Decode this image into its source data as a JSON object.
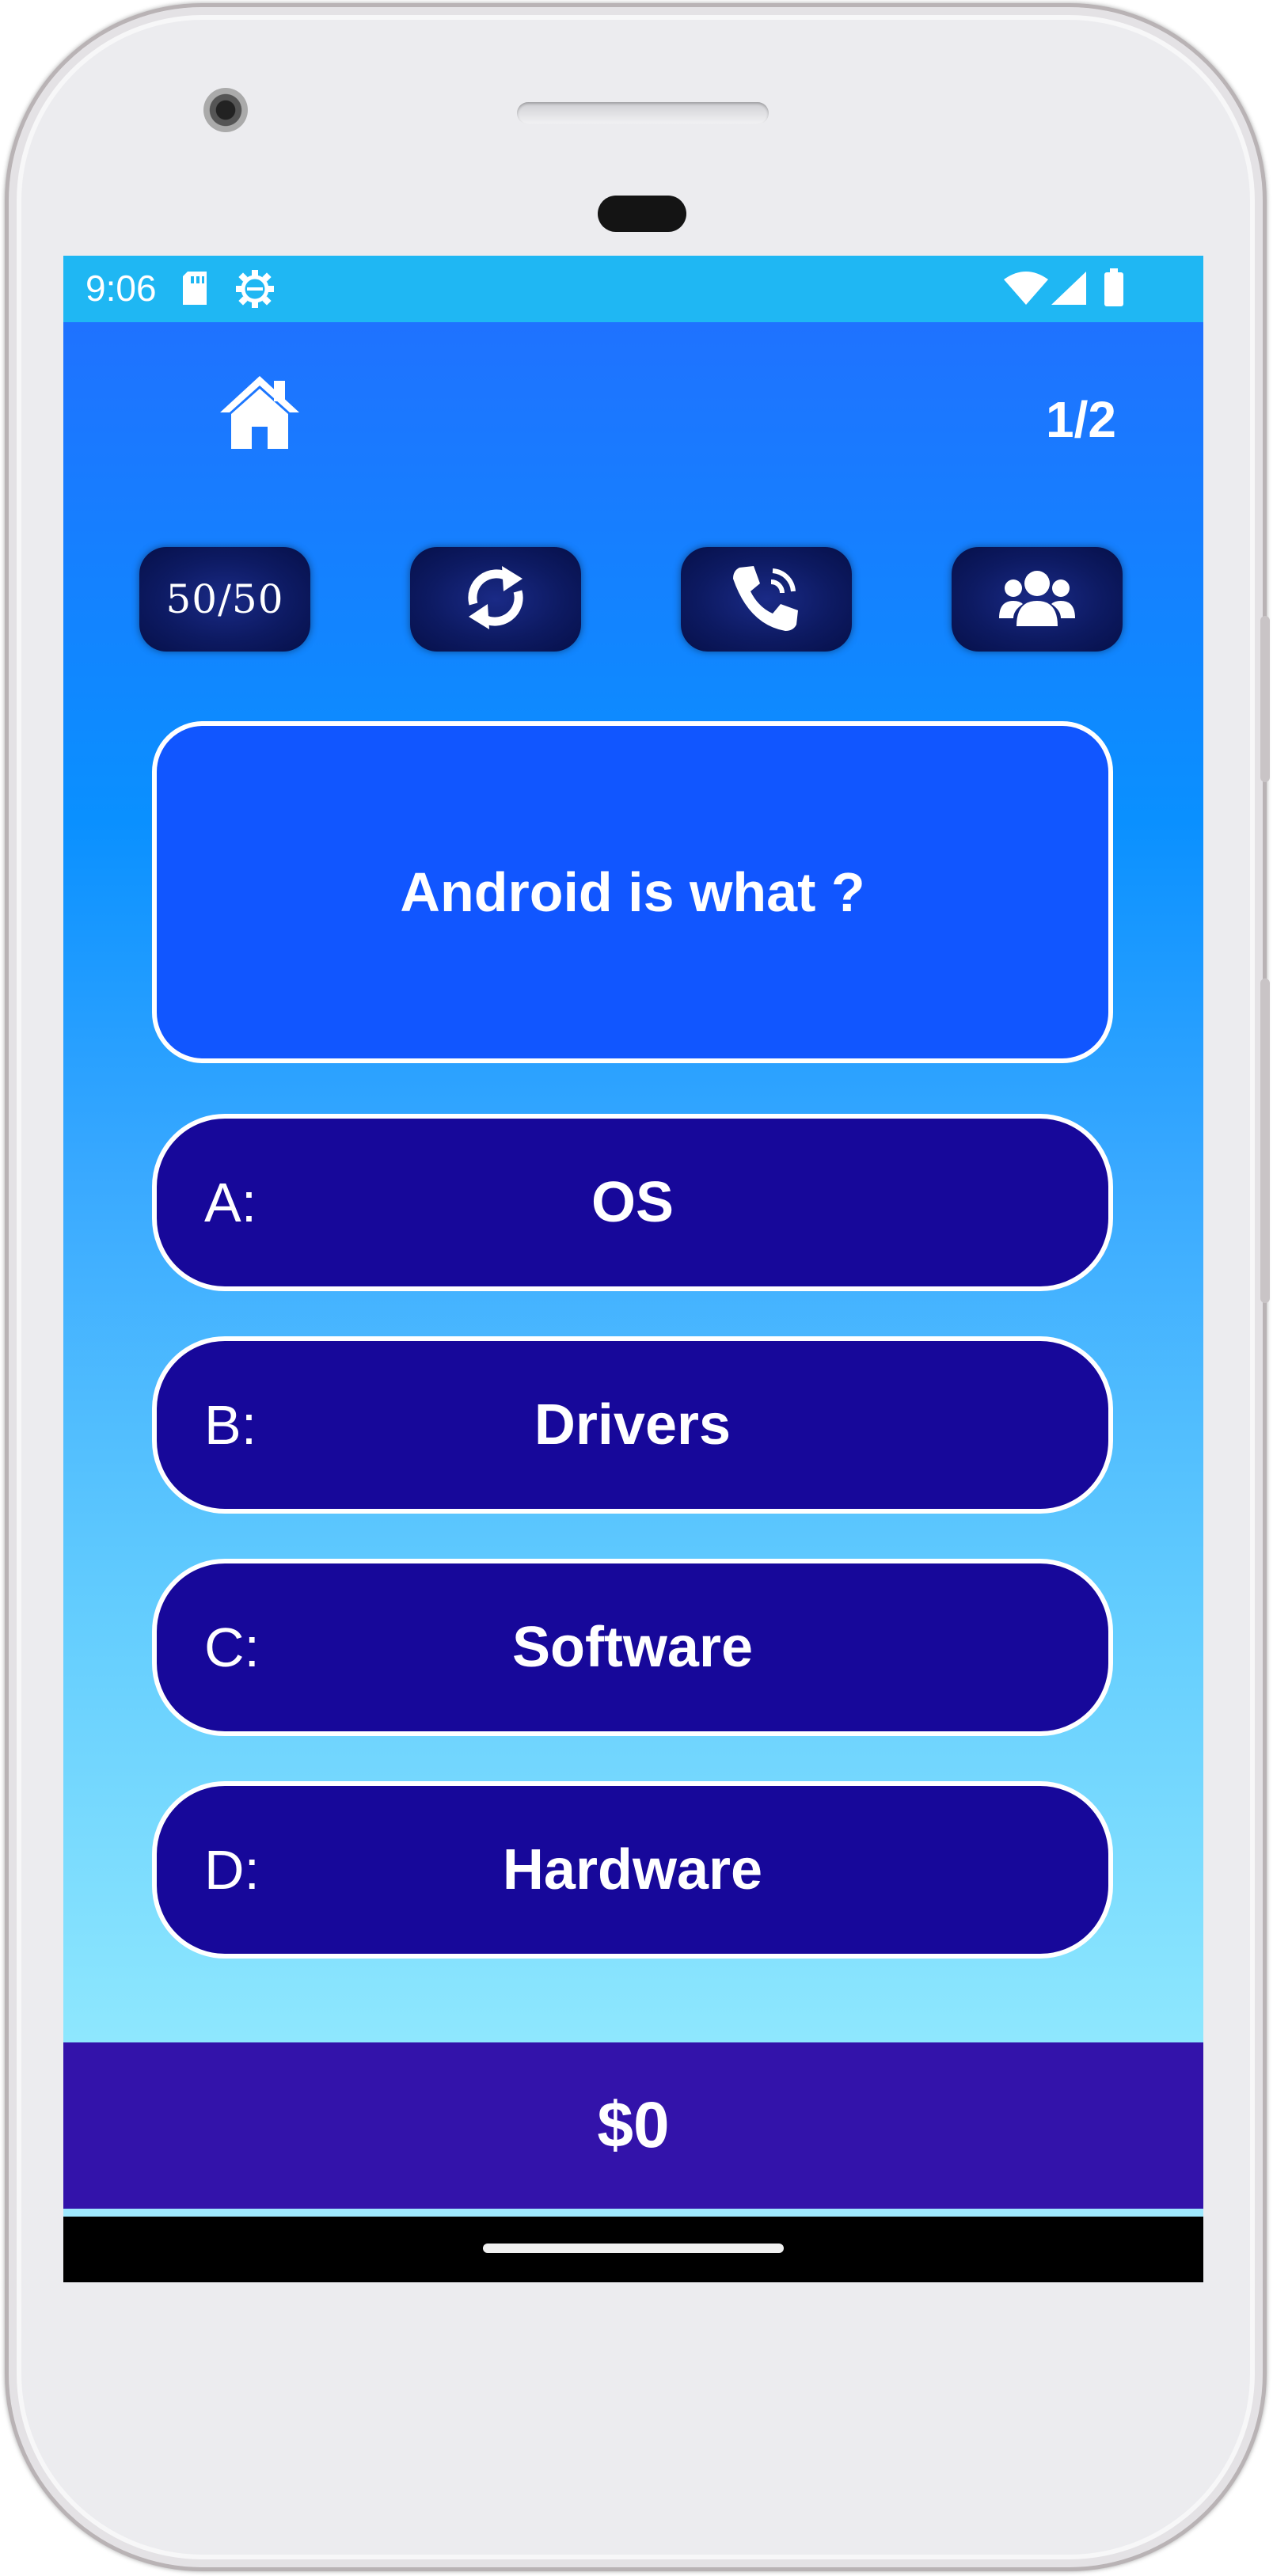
{
  "status_bar": {
    "time": "9:06",
    "icons": [
      "sd-card-icon",
      "settings-gear-icon",
      "wifi-icon",
      "signal-icon",
      "battery-icon"
    ],
    "color": "#1fb7f3"
  },
  "header": {
    "home_icon": "home-icon",
    "progress": "1/2"
  },
  "lifelines": [
    {
      "label": "50/50",
      "icon": "fifty-fifty"
    },
    {
      "icon": "swap-question-icon"
    },
    {
      "icon": "phone-call-icon"
    },
    {
      "icon": "audience-icon"
    }
  ],
  "question": {
    "text": "Android is what ?"
  },
  "answers": [
    {
      "letter": "A:",
      "text": "OS"
    },
    {
      "letter": "B:",
      "text": "Drivers"
    },
    {
      "letter": "C:",
      "text": "Software"
    },
    {
      "letter": "D:",
      "text": "Hardware"
    }
  ],
  "score": {
    "value": "$0"
  },
  "colors": {
    "answer_bg": "#17089a",
    "question_bg": "#1156ff",
    "score_bg": "#3313aa",
    "lifeline_bg": "#0d1a62"
  }
}
